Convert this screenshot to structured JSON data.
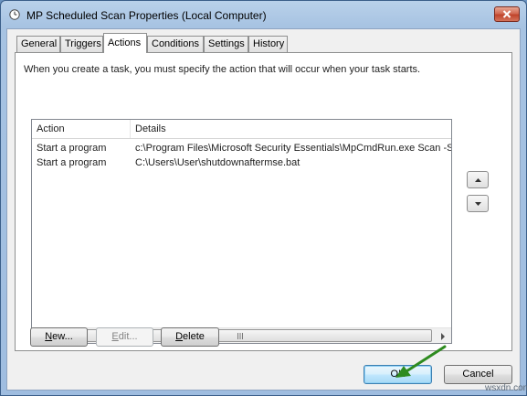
{
  "window": {
    "title": "MP Scheduled Scan Properties (Local Computer)"
  },
  "tabs": [
    {
      "label": "General"
    },
    {
      "label": "Triggers"
    },
    {
      "label": "Actions"
    },
    {
      "label": "Conditions"
    },
    {
      "label": "Settings"
    },
    {
      "label": "History"
    }
  ],
  "active_tab": "Actions",
  "actions_panel": {
    "description": "When you create a task, you must specify the action that will occur when your task starts.",
    "columns": [
      "Action",
      "Details"
    ],
    "rows": [
      {
        "action": "Start a program",
        "details": "c:\\Program Files\\Microsoft Security Essentials\\MpCmdRun.exe Scan -Sche"
      },
      {
        "action": "Start a program",
        "details": "C:\\Users\\User\\shutdownaftermse.bat"
      }
    ],
    "buttons": {
      "new": {
        "pre": "",
        "mnemonic": "N",
        "post": "ew..."
      },
      "edit": {
        "pre": "",
        "mnemonic": "E",
        "post": "dit..."
      },
      "delete": {
        "pre": "",
        "mnemonic": "D",
        "post": "elete"
      }
    }
  },
  "footer": {
    "ok": "OK",
    "cancel": "Cancel"
  },
  "watermark": "wsxdn.com",
  "colors": {
    "pointer_arrow": "#2e8b1f",
    "title_gradient": "#b9d1ea",
    "close_button": "#c0442b"
  },
  "icons": {
    "title": "clock-icon",
    "close": "close-icon",
    "move_up": "triangle-up-icon",
    "move_down": "triangle-down-icon",
    "scroll_left": "scroll-left-icon",
    "scroll_right": "scroll-right-icon",
    "pointer": "green-arrow-icon"
  }
}
